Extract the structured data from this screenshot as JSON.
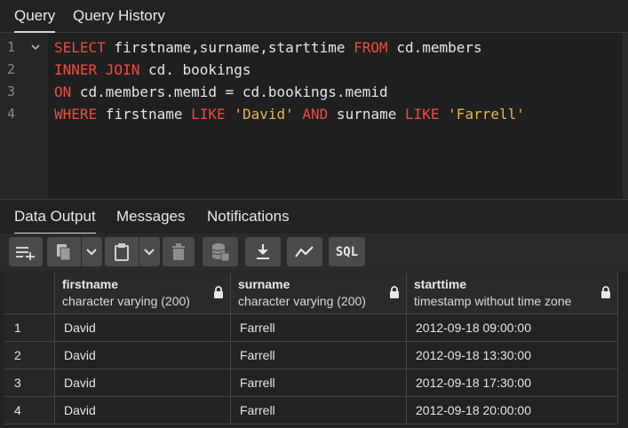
{
  "top_tabs": [
    "Query",
    "Query History"
  ],
  "editor": {
    "line_numbers": [
      "1",
      "2",
      "3",
      "4"
    ],
    "lines": [
      [
        {
          "t": "SELECT",
          "c": "kw"
        },
        {
          "t": " firstname,surname,starttime ",
          "c": "id"
        },
        {
          "t": "FROM",
          "c": "kw"
        },
        {
          "t": " cd.members",
          "c": "id"
        }
      ],
      [
        {
          "t": "INNER JOIN",
          "c": "kw"
        },
        {
          "t": " cd. bookings",
          "c": "id"
        }
      ],
      [
        {
          "t": "ON",
          "c": "kw"
        },
        {
          "t": " cd.members.memid = cd.bookings.memid",
          "c": "id"
        }
      ],
      [
        {
          "t": "WHERE",
          "c": "kw"
        },
        {
          "t": " firstname ",
          "c": "id"
        },
        {
          "t": "LIKE",
          "c": "kw"
        },
        {
          "t": " ",
          "c": "id"
        },
        {
          "t": "'David'",
          "c": "str"
        },
        {
          "t": " ",
          "c": "id"
        },
        {
          "t": "AND",
          "c": "kw"
        },
        {
          "t": " surname ",
          "c": "id"
        },
        {
          "t": "LIKE",
          "c": "kw"
        },
        {
          "t": " ",
          "c": "id"
        },
        {
          "t": "'Farrell'",
          "c": "str"
        }
      ]
    ]
  },
  "bottom_tabs": [
    "Data Output",
    "Messages",
    "Notifications"
  ],
  "toolbar": {
    "sql_label": "SQL"
  },
  "grid": {
    "columns": [
      {
        "name": "firstname",
        "type": "character varying (200)"
      },
      {
        "name": "surname",
        "type": "character varying (200)"
      },
      {
        "name": "starttime",
        "type": "timestamp without time zone"
      }
    ],
    "rows": [
      {
        "n": "1",
        "firstname": "David",
        "surname": "Farrell",
        "starttime": "2012-09-18 09:00:00"
      },
      {
        "n": "2",
        "firstname": "David",
        "surname": "Farrell",
        "starttime": "2012-09-18 13:30:00"
      },
      {
        "n": "3",
        "firstname": "David",
        "surname": "Farrell",
        "starttime": "2012-09-18 17:30:00"
      },
      {
        "n": "4",
        "firstname": "David",
        "surname": "Farrell",
        "starttime": "2012-09-18 20:00:00"
      }
    ]
  },
  "colors": {
    "keyword": "#ee4c3d",
    "string": "#e8b64b",
    "background": "#222222"
  }
}
